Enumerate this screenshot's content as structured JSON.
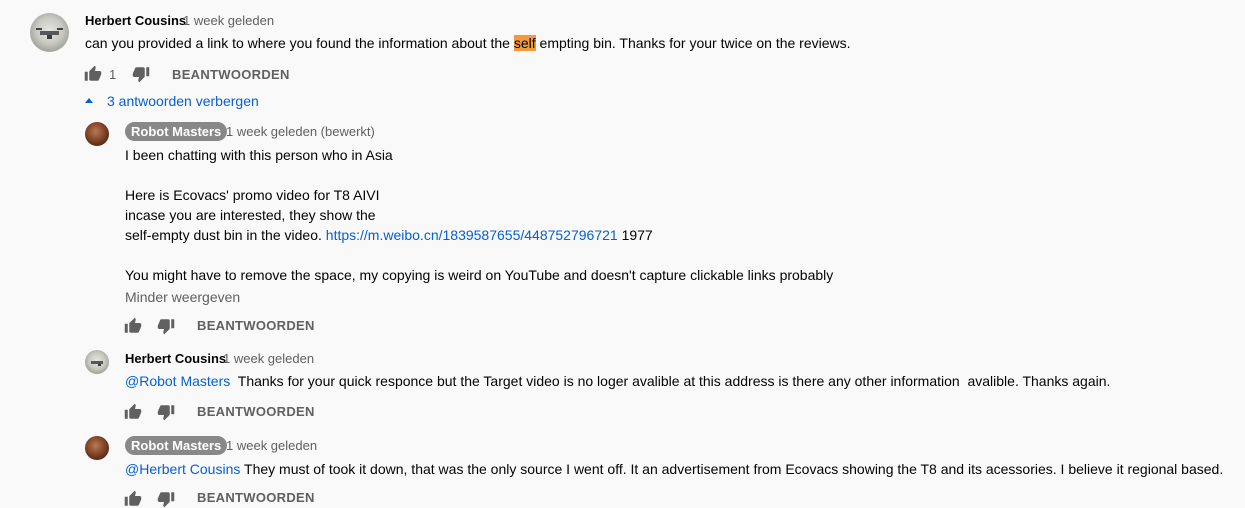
{
  "comment": {
    "author": "Herbert Cousins",
    "time": "1 week geleden",
    "text_before": "can you provided a link to where you found the information about the ",
    "text_highlight": "self",
    "text_after": " empting bin. Thanks for your twice on the reviews.",
    "like_count": "1",
    "reply_label": "BEANTWOORDEN"
  },
  "replies_toggle": {
    "label": "3 antwoorden verbergen",
    "icon": "chevron-up-icon"
  },
  "replies": [
    {
      "author": "Robot Masters",
      "time": "1 week geleden (bewerkt)",
      "line1": "I been chatting with this person who in Asia",
      "line2": "Here is Ecovacs' promo video for T8 AIVI",
      "line3": "incase you are interested, they show the",
      "line4_before": "self-empty dust bin in the video. ",
      "line4_link": "https://m.weibo.cn/1839587655/448752796721",
      "line4_after": " 1977",
      "line5": "You might have to remove the space, my copying is weird on YouTube and doesn't capture clickable links probably",
      "show_less": "Minder weergeven",
      "reply_label": "BEANTWOORDEN"
    },
    {
      "author": "Herbert Cousins",
      "time": "1 week geleden",
      "mention": "@Robot Masters",
      "text": "  Thanks for your quick responce but the Target video is no loger avalible at this address is there any other information  avalible. Thanks again.",
      "reply_label": "BEANTWOORDEN"
    },
    {
      "author": "Robot Masters",
      "time": "1 week geleden",
      "mention": "@Herbert Cousins",
      "text": " They must of took it down, that was the only source I went off. It an advertisement from Ecovacs showing the T8 and its acessories. I believe it regional based.",
      "reply_label": "BEANTWOORDEN"
    }
  ],
  "colors": {
    "link": "#065fd4",
    "highlight": "#f09a3e",
    "badge": "#888888",
    "secondary_text": "#606060"
  }
}
